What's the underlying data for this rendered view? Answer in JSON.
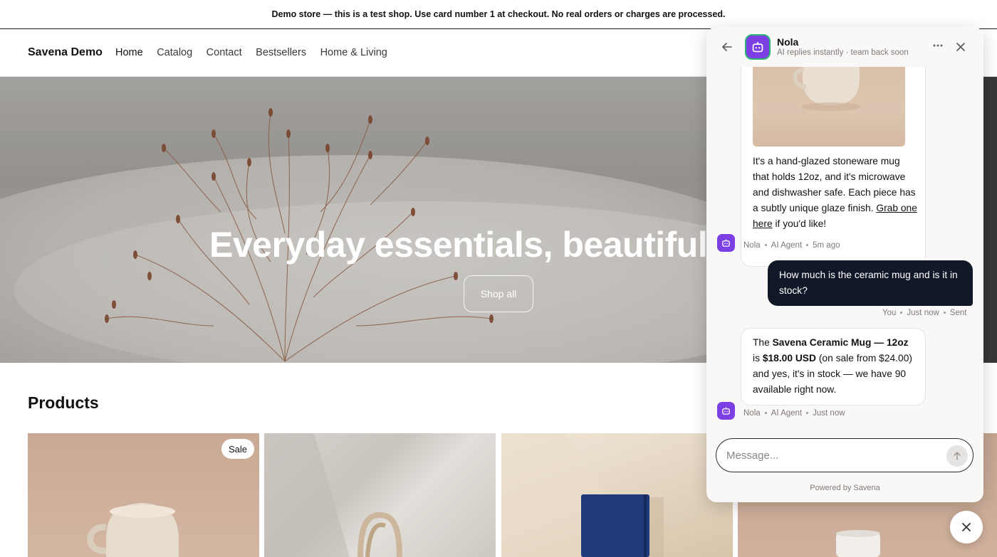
{
  "announcement": "Demo store — this is a test shop. Use card number 1 at checkout. No real orders or charges are processed.",
  "header": {
    "brand": "Savena Demo",
    "nav": [
      "Home",
      "Catalog",
      "Contact",
      "Bestsellers",
      "Home & Living"
    ]
  },
  "hero": {
    "title": "Everyday essentials, beautifully m",
    "button": "Shop all"
  },
  "products": {
    "title": "Products",
    "badge": "Sale"
  },
  "chat": {
    "agent_name": "Nola",
    "status": "AI replies instantly · team back soon",
    "messages": {
      "bot1_text": "It's a hand-glazed stoneware mug that holds 12oz, and it's microwave and dishwasher safe. Each piece has a subtly unique glaze finish.",
      "bot1_link": "Grab one here",
      "bot1_suffix": " if you'd like!",
      "bot1_meta": [
        "Nola",
        "AI Agent",
        "5m ago"
      ],
      "user_text": "How much is the ceramic mug and is it in stock?",
      "user_meta": [
        "You",
        "Just now",
        "Sent"
      ],
      "bot2_pre": "The ",
      "bot2_product": "Savena Ceramic Mug — 12oz",
      "bot2_mid": " is ",
      "bot2_price": "$18.00 USD",
      "bot2_post": " (on sale from $24.00) and yes, it's in stock — we have 90 available right now.",
      "bot2_meta": [
        "Nola",
        "AI Agent",
        "Just now"
      ]
    },
    "input_placeholder": "Message...",
    "powered_by": "Powered by Savena"
  },
  "colors": {
    "agent_purple": "#7b3fe4",
    "user_bubble": "#111827",
    "online_ring": "#2bb673"
  }
}
